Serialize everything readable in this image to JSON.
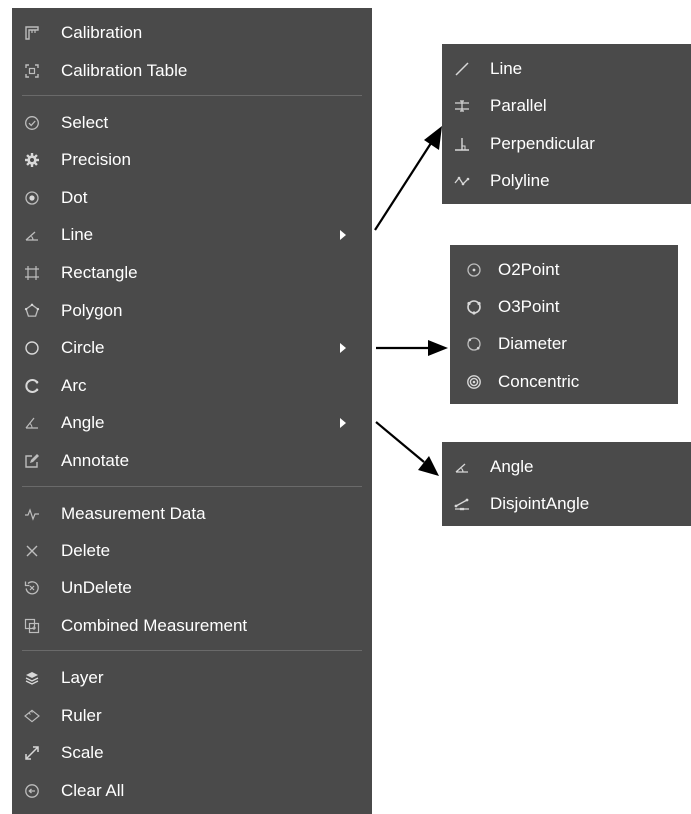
{
  "context_menu": {
    "items": [
      {
        "label": "Calibration",
        "icon": "calibration-icon"
      },
      {
        "label": "Calibration Table",
        "icon": "calibration-table-icon"
      },
      {
        "label": "Select",
        "icon": "select-icon"
      },
      {
        "label": "Precision",
        "icon": "gear-icon"
      },
      {
        "label": "Dot",
        "icon": "dot-icon"
      },
      {
        "label": "Line",
        "icon": "line-icon",
        "has_submenu": true
      },
      {
        "label": "Rectangle",
        "icon": "rectangle-icon"
      },
      {
        "label": "Polygon",
        "icon": "polygon-icon"
      },
      {
        "label": "Circle",
        "icon": "circle-icon",
        "has_submenu": true
      },
      {
        "label": "Arc",
        "icon": "arc-icon"
      },
      {
        "label": "Angle",
        "icon": "angle-icon",
        "has_submenu": true
      },
      {
        "label": "Annotate",
        "icon": "annotate-icon"
      },
      {
        "label": "Measurement Data",
        "icon": "measurement-data-icon"
      },
      {
        "label": "Delete",
        "icon": "close-icon"
      },
      {
        "label": "UnDelete",
        "icon": "undelete-icon"
      },
      {
        "label": "Combined Measurement",
        "icon": "combined-icon"
      },
      {
        "label": "Layer",
        "icon": "layer-icon"
      },
      {
        "label": "Ruler",
        "icon": "ruler-icon"
      },
      {
        "label": "Scale",
        "icon": "scale-icon"
      },
      {
        "label": "Clear All",
        "icon": "clear-all-icon"
      }
    ]
  },
  "submenus": {
    "line": {
      "items": [
        {
          "label": "Line",
          "icon": "line-icon"
        },
        {
          "label": "Parallel",
          "icon": "parallel-icon"
        },
        {
          "label": "Perpendicular",
          "icon": "perpendicular-icon"
        },
        {
          "label": "Polyline",
          "icon": "polyline-icon"
        }
      ]
    },
    "circle": {
      "items": [
        {
          "label": "O2Point",
          "icon": "o2point-icon"
        },
        {
          "label": "O3Point",
          "icon": "o3point-icon"
        },
        {
          "label": "Diameter",
          "icon": "diameter-icon"
        },
        {
          "label": "Concentric",
          "icon": "concentric-icon"
        }
      ]
    },
    "angle": {
      "items": [
        {
          "label": "Angle",
          "icon": "angle-icon"
        },
        {
          "label": "DisjointAngle",
          "icon": "disjoint-angle-icon"
        }
      ]
    }
  },
  "colors": {
    "menu_bg": "#4a4a4a",
    "text": "#ffffff",
    "icon": "#bdbdbd",
    "separator": "#6a6a6a",
    "pointer": "#000000"
  }
}
